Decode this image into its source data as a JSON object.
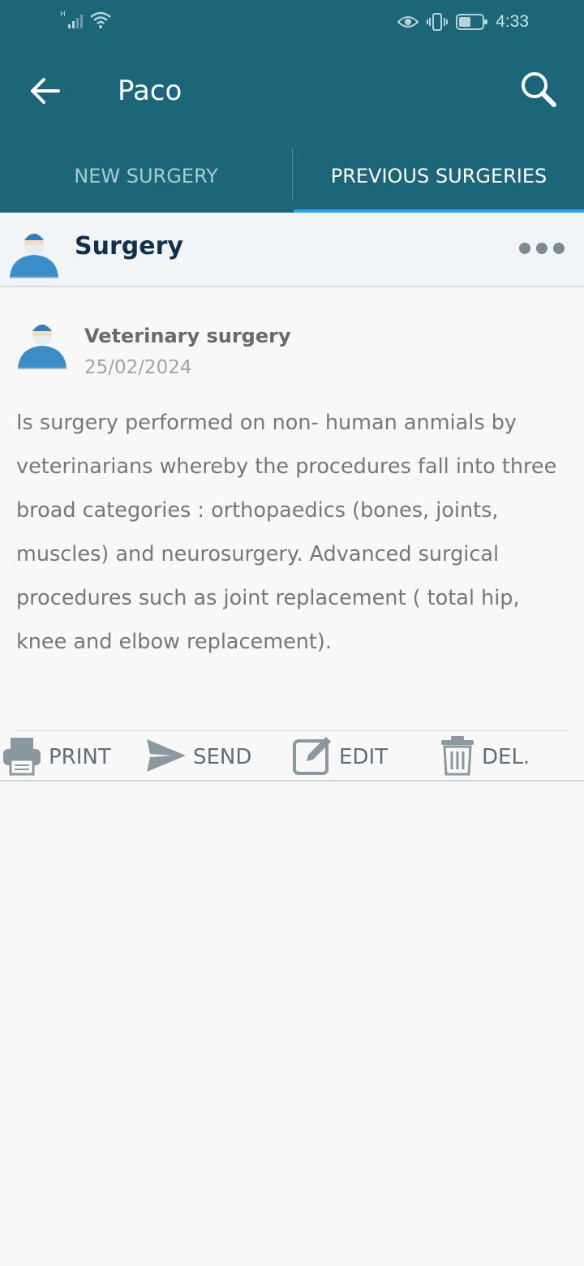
{
  "status_bar": {
    "network_label": "H",
    "time": "4:33",
    "icons": [
      "signal-icon",
      "wifi-icon",
      "eye-icon",
      "vibrate-icon",
      "battery-icon"
    ]
  },
  "toolbar": {
    "title": "Paco",
    "back_icon": "back-arrow-icon",
    "search_icon": "search-icon"
  },
  "tabs": [
    {
      "label": "NEW SURGERY",
      "selected": false
    },
    {
      "label": "PREVIOUS SURGERIES",
      "selected": true
    }
  ],
  "section": {
    "title": "Surgery",
    "more_icon": "more-horizontal-icon"
  },
  "record": {
    "title": "Veterinary surgery",
    "date": "25/02/2024",
    "description": "Is surgery performed on non- human anmials by veterinarians whereby the procedures fall into three broad categories : orthopaedics (bones, joints, muscles) and neurosurgery. Advanced surgical procedures such as joint replacement ( total hip, knee and elbow replacement)."
  },
  "actions": {
    "print": "PRINT",
    "send": "SEND",
    "edit": "EDIT",
    "delete": "DEL."
  },
  "colors": {
    "primary": "#1c6679",
    "tab_indicator": "#2aa6e6",
    "header_title": "#12304a"
  }
}
